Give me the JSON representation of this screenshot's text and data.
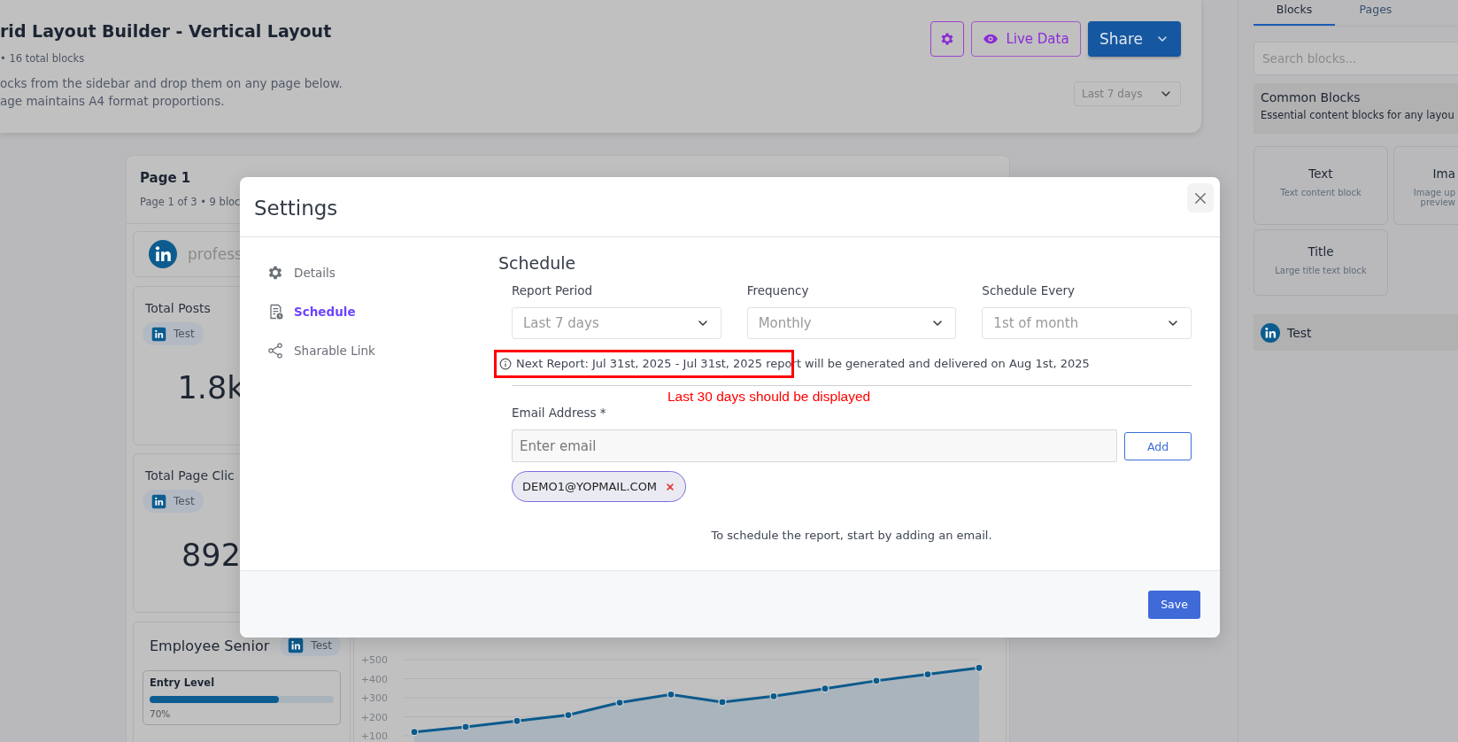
{
  "header": {
    "title": "rid Layout Builder - Vertical Layout",
    "meta": "• 16 total blocks",
    "description": [
      "ocks from the sidebar and drop them on any page below.",
      "age maintains A4 format proportions."
    ],
    "buttons": [
      {
        "kind": "icon"
      },
      {
        "kind": "outline",
        "label": "Live Data"
      },
      {
        "kind": "primary",
        "label": "Share"
      }
    ],
    "period_select": {
      "value": "Last 7 days"
    }
  },
  "page": {
    "title": "Page 1",
    "subtitle": "Page 1 of 3 • 9 bloc",
    "source": {
      "label": "profess"
    },
    "metrics": [
      {
        "title": "Total Posts",
        "tag": "Test",
        "value": "1.8k"
      },
      {
        "title": "Total Page Clic",
        "tag": "Test",
        "value": "892"
      }
    ],
    "breakdown": {
      "title": "Employee Senior",
      "tag": "Test",
      "bars": [
        {
          "label": "Entry Level",
          "level": 0.7,
          "reading": "70%"
        }
      ]
    },
    "chart": {
      "chart_data": {
        "type": "area",
        "ylim": [
          100,
          500
        ],
        "grid": true,
        "values": [
          120,
          147,
          178,
          209,
          274,
          317,
          277,
          308,
          348,
          389,
          423,
          457
        ],
        "yticks": [
          {
            "value": 100,
            "label": "+100"
          },
          {
            "value": 200,
            "label": "+200"
          },
          {
            "value": 300,
            "label": "+300"
          },
          {
            "value": 400,
            "label": "+400"
          },
          {
            "value": 500,
            "label": "+500"
          }
        ]
      }
    }
  },
  "sidebar": {
    "tabs": [
      {
        "label": "Blocks",
        "selected": true
      },
      {
        "label": "Pages",
        "selected": false
      }
    ],
    "search": {
      "placeholder": "Search blocks..."
    },
    "section": {
      "title": "Common Blocks",
      "subtitle": "Essential content blocks for any layou"
    },
    "blocks": [
      {
        "title": "Text",
        "description": [
          "Text content block"
        ]
      },
      {
        "title": "Ima",
        "description": [
          "Image up",
          "preview"
        ]
      },
      {
        "title": "Title",
        "description": [
          "Large title text block"
        ]
      }
    ],
    "sources": [
      {
        "label": "Test"
      }
    ]
  },
  "modal": {
    "title": "Settings",
    "nav": [
      {
        "kind": "details",
        "label": "Details",
        "selected": false
      },
      {
        "kind": "schedule",
        "label": "Schedule",
        "selected": true
      },
      {
        "kind": "link",
        "label": "Sharable Link",
        "selected": false
      }
    ],
    "heading": "Schedule",
    "selects": [
      {
        "label": "Report Period",
        "value": "Last 7 days"
      },
      {
        "label": "Frequency",
        "value": "Monthly"
      },
      {
        "label": "Schedule Every",
        "value": "1st of month"
      }
    ],
    "info": "Next Report: Jul 31st, 2025 - Jul 31st, 2025 report will be generated and delivered on Aug 1st, 2025",
    "email": {
      "label": "Email Address *",
      "placeholder": "Enter email",
      "add_button": "Add"
    },
    "recipients": [
      {
        "email": "DEMO1@YOPMAIL.COM"
      }
    ],
    "hint": "To schedule the report, start by adding an email.",
    "save_button": "Save"
  },
  "annotation": {
    "note": "Last 30 days should be displayed"
  }
}
